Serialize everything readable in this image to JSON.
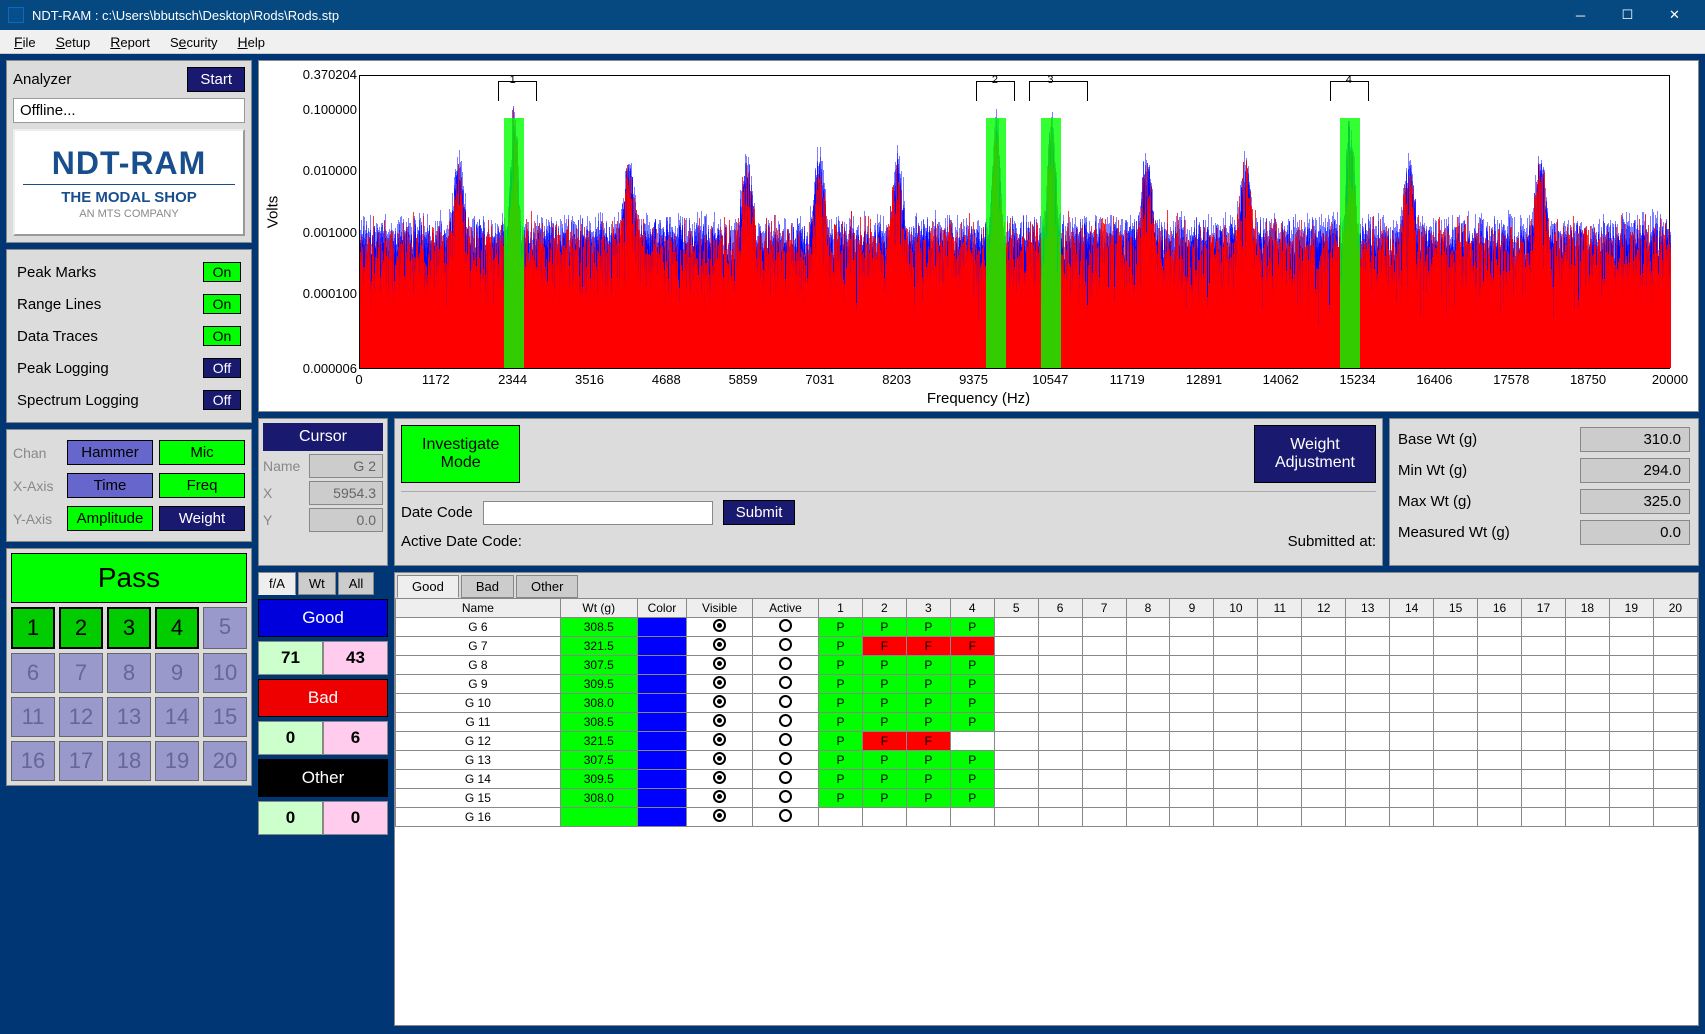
{
  "title": "NDT-RAM : c:\\Users\\bbutsch\\Desktop\\Rods\\Rods.stp",
  "menubar": [
    "File",
    "Setup",
    "Report",
    "Security",
    "Help"
  ],
  "analyzer": {
    "label": "Analyzer",
    "start": "Start",
    "status": "Offline..."
  },
  "logo": {
    "main": "NDT-RAM",
    "sub": "THE MODAL SHOP",
    "mts": "AN MTS COMPANY"
  },
  "toggles": [
    {
      "label": "Peak Marks",
      "state": "On"
    },
    {
      "label": "Range Lines",
      "state": "On"
    },
    {
      "label": "Data Traces",
      "state": "On"
    },
    {
      "label": "Peak Logging",
      "state": "Off"
    },
    {
      "label": "Spectrum Logging",
      "state": "Off"
    }
  ],
  "axes": {
    "chan_label": "Chan",
    "chan_a": "Hammer",
    "chan_b": "Mic",
    "x_label": "X-Axis",
    "x_a": "Time",
    "x_b": "Freq",
    "y_label": "Y-Axis",
    "y_a": "Amplitude",
    "y_b": "Weight"
  },
  "pass": "Pass",
  "numbers": [
    "1",
    "2",
    "3",
    "4",
    "5",
    "6",
    "7",
    "8",
    "9",
    "10",
    "11",
    "12",
    "13",
    "14",
    "15",
    "16",
    "17",
    "18",
    "19",
    "20"
  ],
  "cursor": {
    "header": "Cursor",
    "name_lbl": "Name",
    "name_val": "G 2",
    "x_lbl": "X",
    "x_val": "5954.3",
    "y_lbl": "Y",
    "y_val": "0.0"
  },
  "center": {
    "investigate": "Investigate\nMode",
    "weight_adj": "Weight\nAdjustment",
    "date_label": "Date Code",
    "submit": "Submit",
    "active_date": "Active Date Code:",
    "submitted": "Submitted at:"
  },
  "weights": {
    "base_lbl": "Base Wt (g)",
    "base_val": "310.0",
    "min_lbl": "Min Wt (g)",
    "min_val": "294.0",
    "max_lbl": "Max Wt (g)",
    "max_val": "325.0",
    "meas_lbl": "Measured Wt (g)",
    "meas_val": "0.0"
  },
  "sum_tabs": [
    "f/A",
    "Wt",
    "All"
  ],
  "summary": {
    "good_lbl": "Good",
    "good_g": "71",
    "good_p": "43",
    "bad_lbl": "Bad",
    "bad_g": "0",
    "bad_p": "6",
    "other_lbl": "Other",
    "other_g": "0",
    "other_p": "0"
  },
  "tbl_tabs": [
    "Good",
    "Bad",
    "Other"
  ],
  "tbl_headers": [
    "Name",
    "Wt (g)",
    "Color",
    "Visible",
    "Active",
    "1",
    "2",
    "3",
    "4",
    "5",
    "6",
    "7",
    "8",
    "9",
    "10",
    "11",
    "12",
    "13",
    "14",
    "15",
    "16",
    "17",
    "18",
    "19",
    "20"
  ],
  "rows": [
    {
      "name": "G 6",
      "wt": "308.5",
      "pf": [
        "P",
        "P",
        "P",
        "P"
      ]
    },
    {
      "name": "G 7",
      "wt": "321.5",
      "pf": [
        "P",
        "F",
        "F",
        "F"
      ]
    },
    {
      "name": "G 8",
      "wt": "307.5",
      "pf": [
        "P",
        "P",
        "P",
        "P"
      ]
    },
    {
      "name": "G 9",
      "wt": "309.5",
      "pf": [
        "P",
        "P",
        "P",
        "P"
      ]
    },
    {
      "name": "G 10",
      "wt": "308.0",
      "pf": [
        "P",
        "P",
        "P",
        "P"
      ]
    },
    {
      "name": "G 11",
      "wt": "308.5",
      "pf": [
        "P",
        "P",
        "P",
        "P"
      ]
    },
    {
      "name": "G 12",
      "wt": "321.5",
      "pf": [
        "P",
        "F",
        "F",
        ""
      ]
    },
    {
      "name": "G 13",
      "wt": "307.5",
      "pf": [
        "P",
        "P",
        "P",
        "P"
      ]
    },
    {
      "name": "G 14",
      "wt": "309.5",
      "pf": [
        "P",
        "P",
        "P",
        "P"
      ]
    },
    {
      "name": "G 15",
      "wt": "308.0",
      "pf": [
        "P",
        "P",
        "P",
        "P"
      ]
    },
    {
      "name": "G 16",
      "wt": "",
      "pf": [
        "",
        "",
        "",
        ""
      ]
    }
  ],
  "chart_data": {
    "type": "line",
    "title": "",
    "xlabel": "Frequency (Hz)",
    "ylabel": "Volts",
    "xlim": [
      0,
      20000
    ],
    "ylim": [
      6e-06,
      0.370204
    ],
    "yscale": "log",
    "y_ticks": [
      0.370204,
      0.1,
      0.01,
      0.001,
      0.0001,
      6e-06
    ],
    "x_ticks": [
      0,
      1172,
      2344,
      3516,
      4688,
      5859,
      7031,
      8203,
      9375,
      10547,
      11719,
      12891,
      14062,
      15234,
      16406,
      17578,
      18750,
      20000
    ],
    "peak_markers": [
      {
        "id": 1,
        "freq": 2344,
        "range": [
          2100,
          2700
        ]
      },
      {
        "id": 2,
        "freq": 9700,
        "range": [
          9400,
          10000
        ]
      },
      {
        "id": 3,
        "freq": 10547,
        "range": [
          10200,
          11100
        ]
      },
      {
        "id": 4,
        "freq": 15100,
        "range": [
          14800,
          15400
        ]
      }
    ],
    "series": [
      {
        "name": "good-traces",
        "color": "#0000ff",
        "description": "overlaid spectra of good parts"
      },
      {
        "name": "bad-traces",
        "color": "#ff0000",
        "description": "overlaid spectra of bad parts"
      }
    ]
  }
}
